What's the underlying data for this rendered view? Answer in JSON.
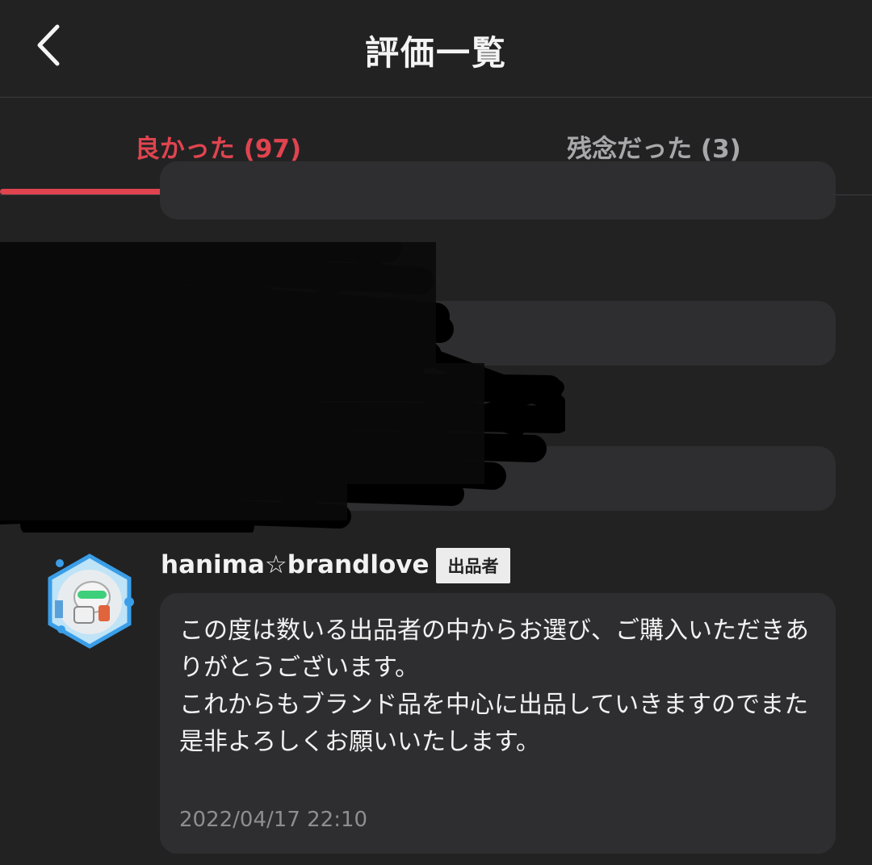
{
  "header": {
    "title": "評価一覧",
    "back_icon": "chevron-left-icon"
  },
  "tabs": [
    {
      "label": "良かった (97)",
      "active": true
    },
    {
      "label": "残念だった (3)",
      "active": false
    }
  ],
  "colors": {
    "accent": "#e0444f",
    "background": "#222223",
    "card": "#2e2e30",
    "badge_bg": "#ececec",
    "muted_text": "#8e8e92"
  },
  "review": {
    "username": "hanima☆brandlove",
    "badge": "出品者",
    "comment": "この度は数いる出品者の中からお選び、ご購入いただきありがとうございます。\nこれからもブランド品を中心に出品していきますのでまた是非よろしくお願いいたします。",
    "date": "2022/04/17 22:10"
  }
}
